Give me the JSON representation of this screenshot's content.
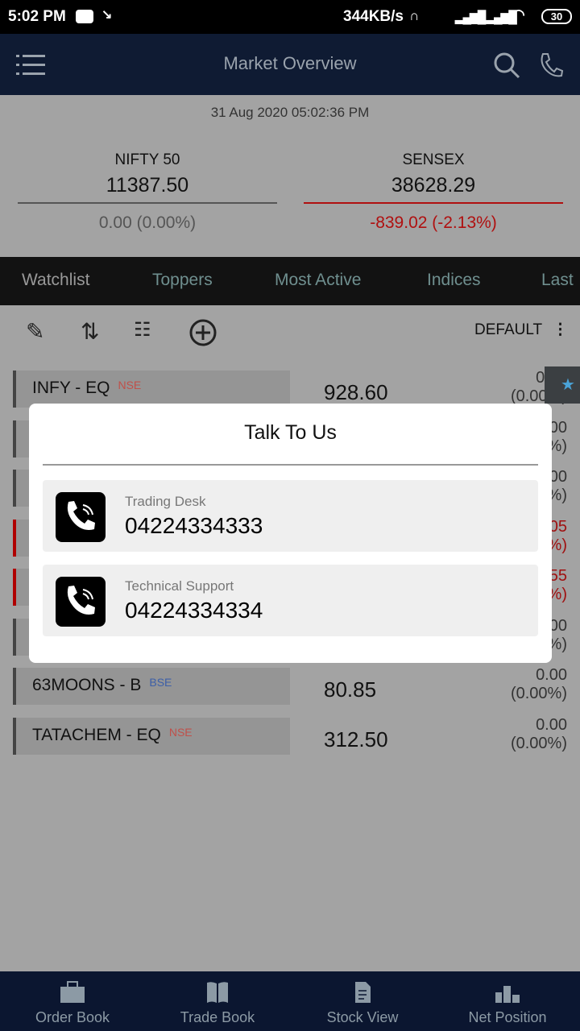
{
  "status_bar": {
    "time": "5:02 PM",
    "speed": "344KB/s",
    "battery": "30"
  },
  "header": {
    "title": "Market Overview",
    "icons": [
      "menu-icon",
      "search-icon",
      "phone-icon"
    ]
  },
  "datetime": "31 Aug 2020 05:02:36 PM",
  "indices": [
    {
      "name": "NIFTY 50",
      "value": "11387.50",
      "change": "0.00 (0.00%)",
      "color": "#555555"
    },
    {
      "name": "SENSEX",
      "value": "38628.29",
      "change": "-839.02 (-2.13%)",
      "color": "#b01010"
    }
  ],
  "tabs": [
    "Watchlist",
    "Toppers",
    "Most Active",
    "Indices",
    "Last"
  ],
  "watchlist": {
    "name": "DEFAULT"
  },
  "rows": [
    {
      "symbol": "INFY  - EQ",
      "exchange": "NSE",
      "price": "928.60",
      "change": "0.00",
      "pct": "(0.00%)",
      "bar": "#444"
    },
    {
      "symbol": "",
      "exchange": "",
      "price": "",
      "change": "00",
      "pct": "%)",
      "bar": "#444"
    },
    {
      "symbol": "",
      "exchange": "",
      "price": "",
      "change": "00",
      "pct": "%)",
      "bar": "#444"
    },
    {
      "symbol": "",
      "exchange": "",
      "price": "",
      "change": "05",
      "pct": "%)",
      "bar": "#b00000"
    },
    {
      "symbol": "",
      "exchange": "",
      "price": "",
      "change": "55",
      "pct": "%)",
      "bar": "#b00000"
    },
    {
      "symbol": "",
      "exchange": "",
      "price": "",
      "change": "00",
      "pct": "%)",
      "bar": "#444"
    },
    {
      "symbol": "63MOONS  - B",
      "exchange": "BSE",
      "price": "80.85",
      "change": "0.00",
      "pct": "(0.00%)",
      "bar": "#444"
    },
    {
      "symbol": "TATACHEM  - EQ",
      "exchange": "NSE",
      "price": "312.50",
      "change": "0.00",
      "pct": "(0.00%)",
      "bar": "#444"
    }
  ],
  "modal": {
    "title": "Talk To Us",
    "contacts": [
      {
        "label": "Trading Desk",
        "phone": "04224334333"
      },
      {
        "label": "Technical Support",
        "phone": "04224334334"
      }
    ]
  },
  "bottom_nav": [
    "Order Book",
    "Trade Book",
    "Stock View",
    "Net Position"
  ]
}
